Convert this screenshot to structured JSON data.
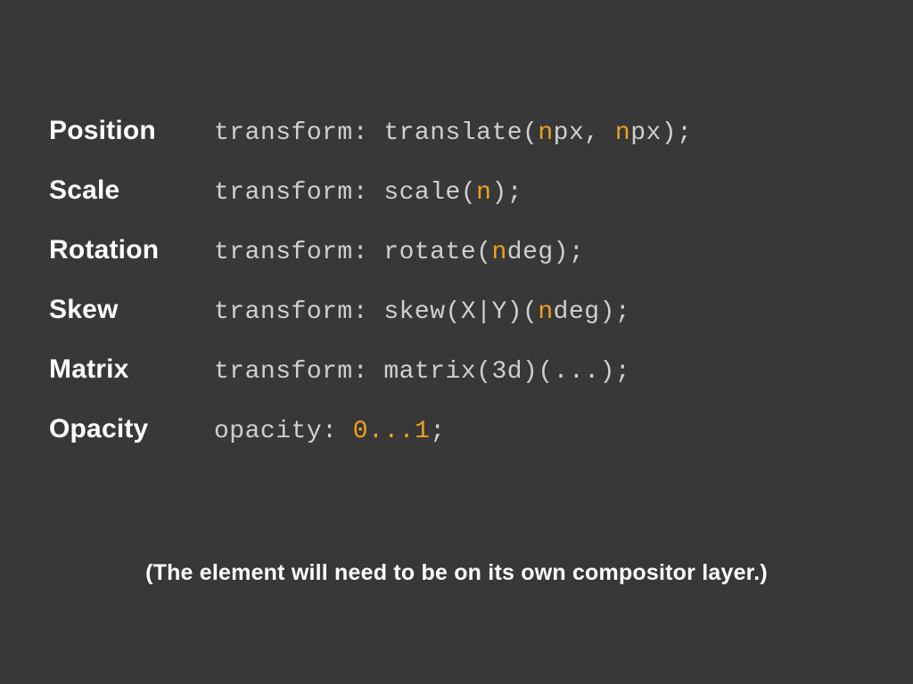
{
  "rows": [
    {
      "label": "Position",
      "code_pre": "transform: translate(",
      "n1": "n",
      "mid1": "px, ",
      "n2": "n",
      "post": "px);"
    },
    {
      "label": "Scale",
      "code_pre": "transform: scale(",
      "n1": "n",
      "mid1": "",
      "n2": "",
      "post": ");"
    },
    {
      "label": "Rotation",
      "code_pre": "transform: rotate(",
      "n1": "n",
      "mid1": "",
      "n2": "",
      "post": "deg);"
    },
    {
      "label": "Skew",
      "code_pre": "transform: skew(X|Y)(",
      "n1": "n",
      "mid1": "",
      "n2": "",
      "post": "deg);"
    },
    {
      "label": "Matrix",
      "code_pre": "transform: matrix(3d)(...);",
      "n1": "",
      "mid1": "",
      "n2": "",
      "post": ""
    },
    {
      "label": "Opacity",
      "code_pre": "opacity: ",
      "n1": "0...1",
      "mid1": "",
      "n2": "",
      "post": ";"
    }
  ],
  "footnote": "(The element will need to be on its own compositor layer.)"
}
